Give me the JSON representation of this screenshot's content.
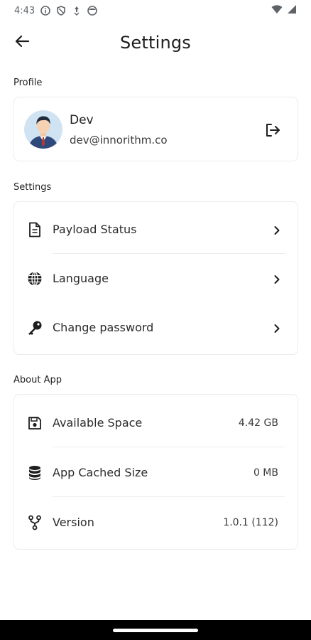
{
  "status_bar": {
    "time": "4:43",
    "icons": [
      "info-icon",
      "shield-icon",
      "data-saver-icon",
      "face-icon"
    ],
    "right_icons": [
      "wifi-icon",
      "cellular-signal-icon"
    ]
  },
  "header": {
    "title": "Settings",
    "back_icon": "arrow-left-icon"
  },
  "profile": {
    "section_label": "Profile",
    "name": "Dev",
    "email": "dev@innorithm.co",
    "action_icon": "logout-icon"
  },
  "settings": {
    "section_label": "Settings",
    "items": [
      {
        "label": "Payload Status",
        "icon": "document-icon"
      },
      {
        "label": "Language",
        "icon": "globe-icon"
      },
      {
        "label": "Change password",
        "icon": "key-icon"
      }
    ]
  },
  "about": {
    "section_label": "About App",
    "items": [
      {
        "label": "Available Space",
        "value": "4.42 GB",
        "icon": "save-disk-icon"
      },
      {
        "label": "App Cached Size",
        "value": "0 MB",
        "icon": "database-icon"
      },
      {
        "label": "Version",
        "value": "1.0.1 (112)",
        "icon": "fork-branch-icon"
      }
    ]
  },
  "colors": {
    "text_primary": "#1e1e1e",
    "card_border": "#ececec",
    "status_icons": "#5f6368",
    "nav_bar": "#000000"
  }
}
